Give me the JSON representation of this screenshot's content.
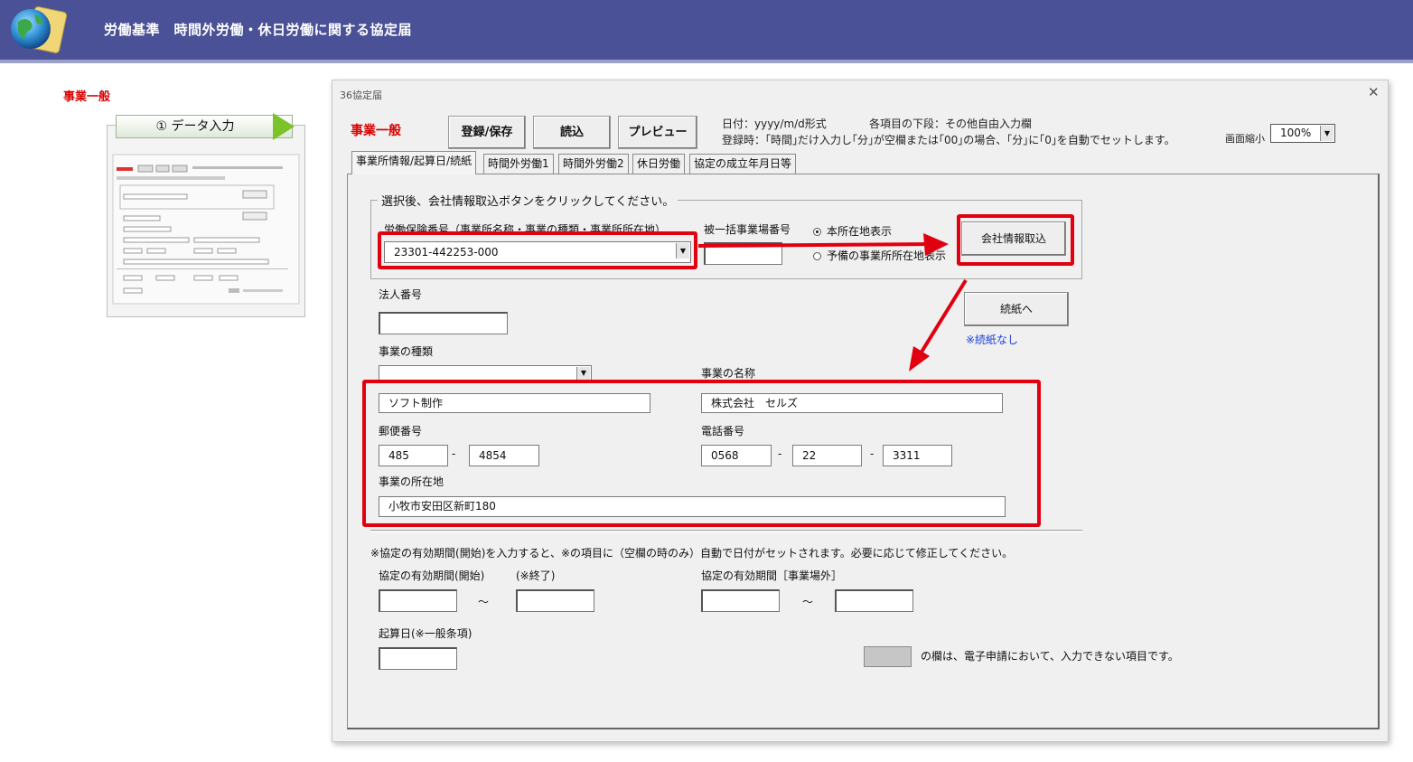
{
  "app": {
    "title": "労働基準　時間外労働・休日労働に関する協定届"
  },
  "side": {
    "title": "事業一般",
    "step_label": "① データ入力"
  },
  "dialog": {
    "title": "36協定届",
    "close_glyph": "✕",
    "form_title": "事業一般",
    "toolbar": {
      "save_label": "登録/保存",
      "load_label": "読込",
      "preview_label": "プレビュー"
    },
    "notes": {
      "date_format": "日付：yyyy/m/d形式",
      "lower_row": "各項目の下段：その他自由入力欄",
      "time_rule": "登録時：｢時間｣だけ入力し｢分｣が空欄または｢00｣の場合、｢分｣に｢0｣を自動でセットします。"
    },
    "zoom": {
      "label": "画面縮小",
      "value": "100%"
    },
    "tabs": [
      {
        "label": "事業所情報/起算日/続紙"
      },
      {
        "label": "時間外労働1"
      },
      {
        "label": "時間外労働2"
      },
      {
        "label": "休日労働"
      },
      {
        "label": "協定の成立年月日等"
      }
    ],
    "group": {
      "caption": "選択後、会社情報取込ボタンをクリックしてください。",
      "insurance_label": "労働保険番号（事業所名称・事業の種類・事業所所在地）",
      "insurance_value": "23301-442253-000",
      "ikkatsu_label": "被一括事業場番号",
      "ikkatsu_value": "",
      "radio_main": "本所在地表示",
      "radio_alt": "予備の事業所所在地表示",
      "import_label": "会社情報取込"
    },
    "houjin_label": "法人番号",
    "houjin_value": "",
    "continue_label": "続紙へ",
    "continue_note": "※続紙なし",
    "jigyou_shurui_label": "事業の種類",
    "jigyou_shurui_select": "",
    "jigyou_shurui_value": "ソフト制作",
    "jigyou_meishou_label": "事業の名称",
    "jigyou_meishou_value": "株式会社　セルズ",
    "postal_label": "郵便番号",
    "postal": [
      "485",
      "4854"
    ],
    "phone_label": "電話番号",
    "phone": [
      "0568",
      "22",
      "3311"
    ],
    "address_label": "事業の所在地",
    "address_value": "小牧市安田区新町180",
    "period_note": "※協定の有効期間(開始)を入力すると、※の項目に（空欄の時のみ）自動で日付がセットされます。必要に応じて修正してください。",
    "period_start_label": "協定の有効期間(開始)",
    "period_end_label": "(※終了)",
    "period_outside_label": "協定の有効期間［事業場外］",
    "tilde": "～",
    "kisan_label": "起算日(※一般条項)",
    "gray_note": "の欄は、電子申請において、入力できない項目です。",
    "dash": "-"
  },
  "colors": {
    "banner": "#4a5196",
    "accent_red": "#e00010",
    "title_red": "#d80000",
    "link_blue": "#1a3fd8"
  }
}
